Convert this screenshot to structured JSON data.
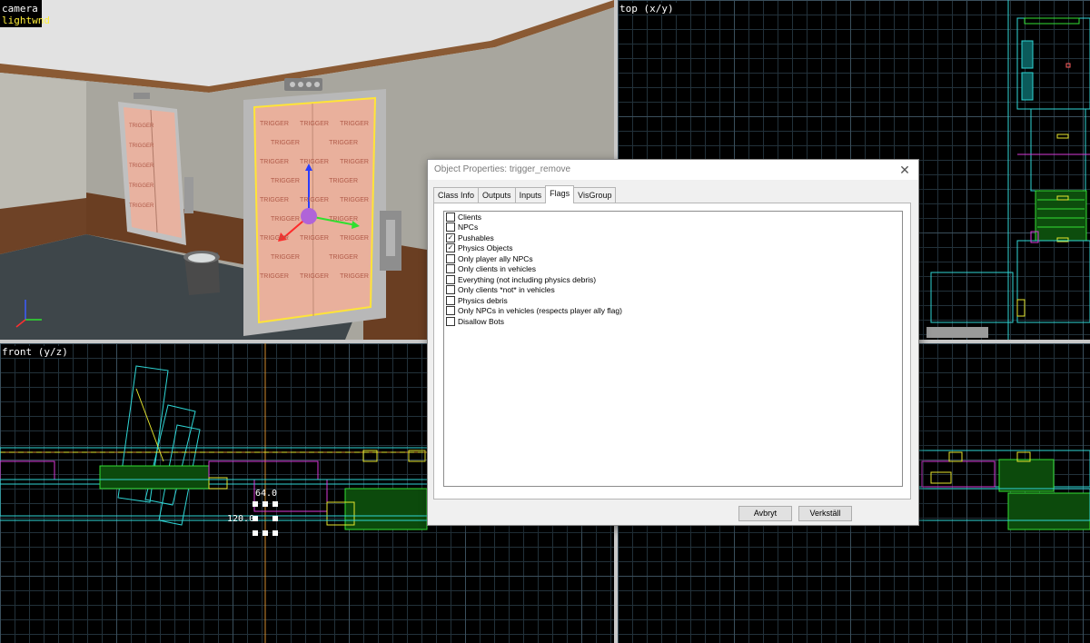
{
  "viewports": {
    "camera": {
      "label": "camera",
      "sublabel": "lightwnd"
    },
    "top": {
      "label": "top (x/y)"
    },
    "front": {
      "label": "front (y/z)",
      "measure_horizontal": "64.0",
      "measure_vertical": "120.0"
    }
  },
  "scene": {
    "trigger_texture_text": "TRIGGER"
  },
  "dialog": {
    "title": "Object Properties: trigger_remove",
    "close_glyph": "✕",
    "tabs": [
      {
        "label": "Class Info",
        "active": false
      },
      {
        "label": "Outputs",
        "active": false
      },
      {
        "label": "Inputs",
        "active": false
      },
      {
        "label": "Flags",
        "active": true
      },
      {
        "label": "VisGroup",
        "active": false
      }
    ],
    "flags": [
      {
        "label": "Clients",
        "checked": false
      },
      {
        "label": "NPCs",
        "checked": false
      },
      {
        "label": "Pushables",
        "checked": true
      },
      {
        "label": "Physics Objects",
        "checked": true
      },
      {
        "label": "Only player ally NPCs",
        "checked": false
      },
      {
        "label": "Only clients in vehicles",
        "checked": false
      },
      {
        "label": "Everything (not including physics debris)",
        "checked": false
      },
      {
        "label": "Only clients *not* in vehicles",
        "checked": false
      },
      {
        "label": "Physics debris",
        "checked": false
      },
      {
        "label": "Only NPCs in vehicles (respects player ally flag)",
        "checked": false
      },
      {
        "label": "Disallow Bots",
        "checked": false
      }
    ],
    "cancel_label": "Avbryt",
    "apply_label": "Verkställ"
  },
  "colors": {
    "grid_minor": "#22313a",
    "grid_major": "#3a4f5c",
    "cyan": "#2fd6d6",
    "magenta": "#d83ad8",
    "green": "#35e035",
    "yellow": "#e6e62e",
    "selection": "#ffe438"
  }
}
